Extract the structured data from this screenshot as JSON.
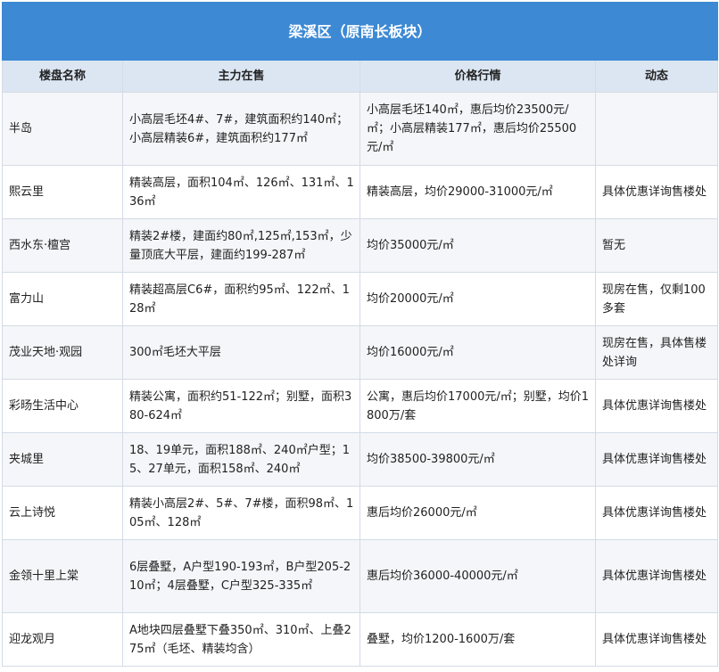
{
  "title": "梁溪区（原南长板块）",
  "columns": [
    "楼盘名称",
    "主力在售",
    "价格行情",
    "动态"
  ],
  "rows": [
    [
      "半岛",
      "小高层毛坯4#、7#，建筑面积约140㎡；小高层精装6#，建筑面积约177㎡",
      "小高层毛坯140㎡，惠后均价23500元/㎡；小高层精装177㎡，惠后均价25500元/㎡",
      ""
    ],
    [
      "熙云里",
      "精装高层，面积104㎡、126㎡、131㎡、136㎡",
      "精装高层，均价29000-31000元/㎡",
      "具体优惠详询售楼处"
    ],
    [
      "西水东·檀宫",
      "精装2#楼，建面约80㎡,125㎡,153㎡，少量顶底大平层，建面约199-287㎡",
      "均价35000元/㎡",
      "暂无"
    ],
    [
      "富力山",
      "精装超高层C6#，面积约95㎡、122㎡、128㎡",
      "均价20000元/㎡",
      "现房在售，仅剩100多套"
    ],
    [
      "茂业天地·观园",
      "300㎡毛坯大平层",
      "均价16000元/㎡",
      "现房在售，具体售楼处详询"
    ],
    [
      "彩旸生活中心",
      "精装公寓，面积约51-122㎡；别墅，面积380-624㎡",
      "公寓，惠后均价17000元/㎡；别墅，均价1800万/套",
      "具体优惠详询售楼处"
    ],
    [
      "夹城里",
      "18、19单元，面积188㎡、240㎡户型；15、27单元，面积158㎡、240㎡",
      "均价38500-39800元/㎡",
      "具体优惠详询售楼处"
    ],
    [
      "云上诗悦",
      "精装小高层2#、5#、7#楼，面积98㎡、105㎡、128㎡",
      "惠后均价26000元/㎡",
      "具体优惠详询售楼处"
    ],
    [
      "金领十里上棠",
      "6层叠墅，A户型190-193㎡，B户型205-210㎡；4层叠墅，C户型325-335㎡",
      "惠后均价36000-40000元/㎡",
      "具体优惠详询售楼处"
    ],
    [
      "迎龙观月",
      "A地块四层叠墅下叠350㎡、310㎡、上叠275㎡（毛坯、精装均含）",
      "叠墅，均价1200-1600万/套",
      "具体优惠详询售楼处"
    ]
  ]
}
